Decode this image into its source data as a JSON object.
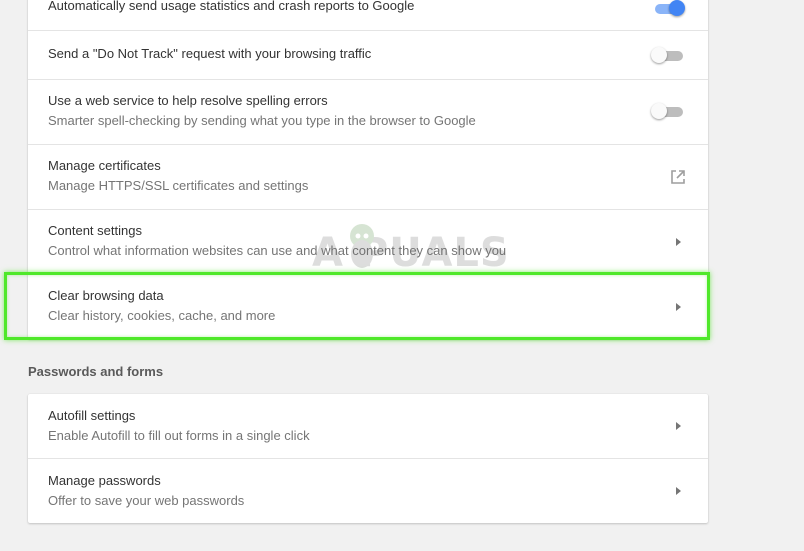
{
  "privacy": {
    "usage_stats": {
      "label": "Automatically send usage statistics and crash reports to Google",
      "enabled": true
    },
    "do_not_track": {
      "label": "Send a \"Do Not Track\" request with your browsing traffic",
      "enabled": false
    },
    "spelling": {
      "label": "Use a web service to help resolve spelling errors",
      "sublabel": "Smarter spell-checking by sending what you type in the browser to Google",
      "enabled": false
    },
    "certificates": {
      "label": "Manage certificates",
      "sublabel": "Manage HTTPS/SSL certificates and settings"
    },
    "content_settings": {
      "label": "Content settings",
      "sublabel": "Control what information websites can use and what content they can show you"
    },
    "clear_browsing": {
      "label": "Clear browsing data",
      "sublabel": "Clear history, cookies, cache, and more"
    }
  },
  "passwords_forms": {
    "title": "Passwords and forms",
    "autofill": {
      "label": "Autofill settings",
      "sublabel": "Enable Autofill to fill out forms in a single click"
    },
    "manage_passwords": {
      "label": "Manage passwords",
      "sublabel": "Offer to save your web passwords"
    }
  },
  "watermark": {
    "text": "A PUALS"
  },
  "colors": {
    "toggle_on": "#4285f4",
    "toggle_off": "#bdbdbd",
    "highlight": "#4fe82a",
    "background": "#f1f1f1"
  }
}
